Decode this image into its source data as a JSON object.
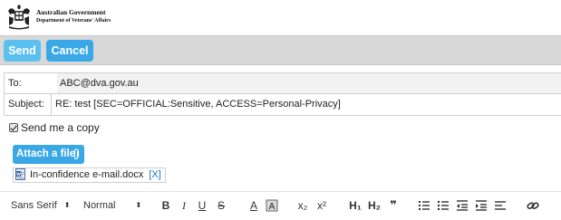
{
  "header": {
    "line1": "Australian Government",
    "line2": "Department of Veterans' Affairs"
  },
  "toolbar": {
    "send_label": "Send",
    "cancel_label": "Cancel"
  },
  "form": {
    "to_label": "To:",
    "to_value": "ABC@dva.gov.au",
    "subject_label": "Subject:",
    "subject_value": "RE: test [SEC=OFFICIAL:Sensitive, ACCESS=Personal-Privacy]",
    "copy_label": "Send me a copy",
    "copy_checked": true
  },
  "attachments": {
    "button_label": "Attach a file",
    "files": [
      {
        "name": "In-confidence e-mail.docx",
        "remove_label": "[X]"
      }
    ]
  },
  "editor_toolbar": {
    "font_family": "Sans Serif",
    "font_size": "Normal",
    "buttons": [
      "bold-icon",
      "italic-icon",
      "underline-icon",
      "strikethrough-icon",
      "font-color-icon",
      "background-color-icon",
      "subscript-icon",
      "superscript-icon",
      "heading-1-icon",
      "heading-2-icon",
      "blockquote-icon",
      "ordered-list-icon",
      "bullet-list-icon",
      "outdent-icon",
      "indent-icon",
      "align-icon",
      "link-icon"
    ],
    "labels": {
      "bold": "B",
      "italic": "I",
      "underline": "U",
      "strike": "S",
      "font_color": "A",
      "bg_color": "A",
      "subscript": "x₂",
      "superscript": "x²",
      "h1": "H₁",
      "h2": "H₂",
      "quote": "❞"
    }
  },
  "colors": {
    "accent": "#3aa8e6",
    "send": "#5bc0f0",
    "toolbar_bg": "#d8d8d8",
    "link": "#1a6fc4"
  }
}
